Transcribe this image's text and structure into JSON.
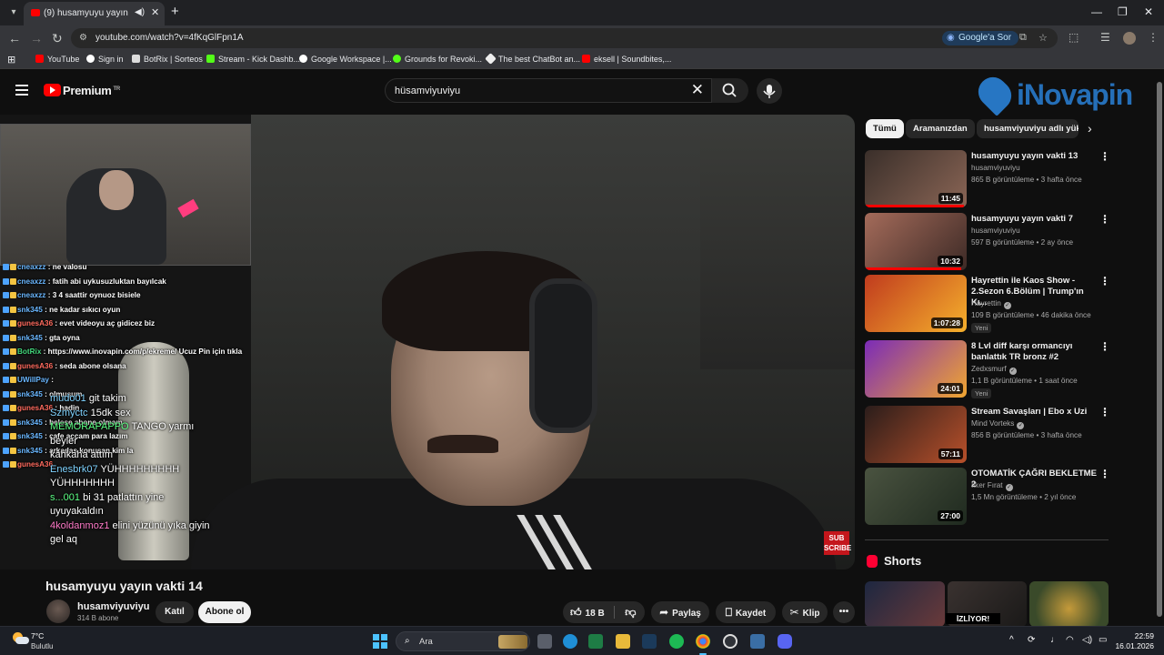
{
  "browser": {
    "tab_title": "(9) husamyuyu yayın vakti 14",
    "url": "youtube.com/watch?v=4fKqGlFpn1A",
    "google_sor_label": "Google'a Sor",
    "bookmarks": [
      {
        "label": "YouTube",
        "color": "#ff0000"
      },
      {
        "label": "Sign in",
        "color": "#ffffff"
      },
      {
        "label": "BotRix | Sorteos",
        "color": "#f1f1f1"
      },
      {
        "label": "Stream - Kick Dashb...",
        "color": "#53fc18"
      },
      {
        "label": "Google Workspace |...",
        "color": "#f1f1f1"
      },
      {
        "label": "Grounds for Revoki...",
        "color": "#53fc18"
      },
      {
        "label": "The best ChatBot an...",
        "color": "#f1f1f1"
      },
      {
        "label": "eksell | Soundbites,...",
        "color": "#ff0000"
      }
    ]
  },
  "youtube": {
    "brand": "Premium",
    "region": "TR",
    "search_query": "hüsamviyuviyu",
    "overlay_logo_text": "iNovapin",
    "video": {
      "title": "husamyuyu yayın vakti 14",
      "channel": "husamviyuviyu",
      "subscribers": "314 B abone",
      "join_label": "Katıl",
      "subscribe_label": "Abone ol",
      "likes": "18 B",
      "share_label": "Paylaş",
      "save_label": "Kaydet",
      "clip_label": "Klip",
      "sub_badge": "SUB SCRIBE"
    },
    "chat": [
      {
        "user": "cneaxzz",
        "text": ": ne valosu",
        "color": "blue"
      },
      {
        "user": "cneaxzz",
        "text": ": fatih abi uykusuzluktan bayılcak",
        "color": "blue"
      },
      {
        "user": "cneaxzz",
        "text": ": 3 4 saattir oynuoz bisiele",
        "color": "blue"
      },
      {
        "user": "snk345",
        "text": ": ne kadar sıkıcı oyun",
        "color": "blue"
      },
      {
        "user": "gunesA36",
        "text": ": evet videoyu aç gidicez biz",
        "color": "red"
      },
      {
        "user": "snk345",
        "text": ": gta oyna",
        "color": "blue"
      },
      {
        "user": "BotRix",
        "text": ": https://www.inovapin.com/p/ekreme/ Ucuz Pin için tıkla",
        "color": "green"
      },
      {
        "user": "gunesA36",
        "text": ": seda abone olsana",
        "color": "red"
      },
      {
        "user": "UWillPay",
        "text": ":",
        "color": "blue"
      },
      {
        "user": "snk345",
        "text": ": olmuşum",
        "color": "blue"
      },
      {
        "user": "gunesA36",
        "text": ": hadin",
        "color": "red"
      },
      {
        "user": "snk345",
        "text": ": beleşe abone olmam",
        "color": "blue"
      },
      {
        "user": "snk345",
        "text": ": cafe açcam para lazım",
        "color": "blue"
      },
      {
        "user": "snk345",
        "text": ": arkadaş konuşan kim la",
        "color": "blue"
      },
      {
        "user": "gunesA36",
        "text": "",
        "color": "red"
      }
    ],
    "kick_chat": [
      {
        "user": "mudo01",
        "text": "git takim",
        "color": "blue"
      },
      {
        "user": "Szmyctc",
        "text": "15dk sex",
        "color": "blue"
      },
      {
        "user": "MEMORAPAPPO",
        "text": "TANGO yarmı",
        "color": "green"
      },
      {
        "user": "",
        "text": "beyler",
        "color": "blue"
      },
      {
        "user": "",
        "text": "kahkaha attım",
        "color": "blue"
      },
      {
        "user": "Enesbrk07",
        "text": "YÜHHHHHHHHH",
        "color": "blue"
      },
      {
        "user": "",
        "text": "YÜHHHHHHH",
        "color": "blue"
      },
      {
        "user": "s...001",
        "text": "bi 31 patlattın yine",
        "color": "green"
      },
      {
        "user": "",
        "text": "uyuyakaldın",
        "color": "blue"
      },
      {
        "user": "4koldanmoz1",
        "text": "elini yüzünü yıka giyin",
        "color": "pink"
      },
      {
        "user": "",
        "text": "gel aq",
        "color": "blue"
      }
    ],
    "filter_chips": [
      "Tümü",
      "Aramanızdan",
      "husamviyuviyu adlı yükle"
    ],
    "related": [
      {
        "title": "husamyuyu yayın vakti 13",
        "channel": "husamviyuviyu",
        "meta": "865 B görüntüleme • 3 hafta önce",
        "duration": "11:45",
        "new": "",
        "verified": false,
        "progress": 0.97,
        "thumb": [
          "#3a2f2a",
          "#8a6555"
        ]
      },
      {
        "title": "husamyuyu yayın vakti 7",
        "channel": "husamviyuviyu",
        "meta": "597 B görüntüleme • 2 ay önce",
        "duration": "10:32",
        "new": "",
        "verified": false,
        "progress": 0.95,
        "thumb": [
          "#a46b5a",
          "#3d2a26"
        ]
      },
      {
        "title": "Hayrettin ile Kaos Show - 2.Sezon 6.Bölüm | Trump'ın Kı...",
        "channel": "Hayrettin",
        "meta": "109 B görüntüleme • 46 dakika önce",
        "duration": "1:07:28",
        "new": "Yeni",
        "verified": true,
        "progress": 0,
        "thumb": [
          "#c03b1e",
          "#f5b02c"
        ]
      },
      {
        "title": "8 Lvl diff karşı ormancıyı banlattık TR bronz #2",
        "channel": "Zedxsmurf",
        "meta": "1,1 B görüntüleme • 1 saat önce",
        "duration": "24:01",
        "new": "Yeni",
        "verified": true,
        "progress": 0,
        "thumb": [
          "#7b2bb8",
          "#f0a630"
        ]
      },
      {
        "title": "Stream Savaşları | Ebo x Uzi",
        "channel": "Mind Vorteks",
        "meta": "856 B görüntüleme • 3 hafta önce",
        "duration": "57:11",
        "new": "",
        "verified": true,
        "progress": 0,
        "thumb": [
          "#2a1d1b",
          "#b8502a"
        ]
      },
      {
        "title": "OTOMATİK ÇAĞRI BEKLETME 2",
        "channel": "İlker Fırat",
        "meta": "1,5 Mn görüntüleme • 2 yıl önce",
        "duration": "27:00",
        "new": "",
        "verified": true,
        "progress": 0,
        "thumb": [
          "#4a5340",
          "#1f2a1f"
        ]
      }
    ],
    "shorts_title": "Shorts",
    "shorts_badge": "İZLİYOR!"
  },
  "taskbar": {
    "temperature": "7°C",
    "condition": "Bulutlu",
    "search_label": "Ara",
    "time": "22:59",
    "date": "16.01.2026"
  }
}
